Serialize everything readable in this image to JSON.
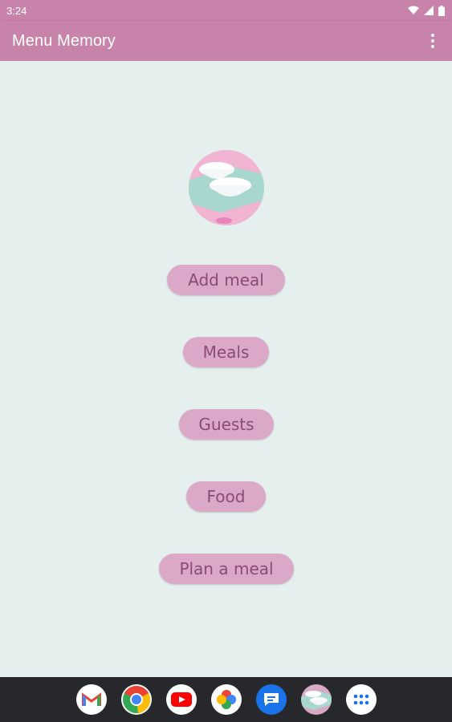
{
  "status_bar": {
    "time": "3:24"
  },
  "app_bar": {
    "title": "Menu Memory",
    "menu_icon": "more-vertical-icon"
  },
  "logo": {
    "icon": "stacked-bowls-logo",
    "colors": {
      "pink": "#f1b4d2",
      "teal": "#a7d7cf",
      "bowl": "#ffffff"
    }
  },
  "buttons": {
    "add_meal": "Add meal",
    "meals": "Meals",
    "guests": "Guests",
    "food": "Food",
    "plan_meal": "Plan a meal"
  },
  "taskbar": {
    "apps": [
      "gmail-icon",
      "chrome-icon",
      "youtube-icon",
      "photos-icon",
      "messages-icon",
      "menu-memory-icon",
      "app-drawer-icon"
    ]
  },
  "colors": {
    "app_bar": "#c883ab",
    "background": "#e5f0ee",
    "button": "#dba8c8",
    "button_text": "#8a4c73",
    "taskbar": "#26282b"
  }
}
